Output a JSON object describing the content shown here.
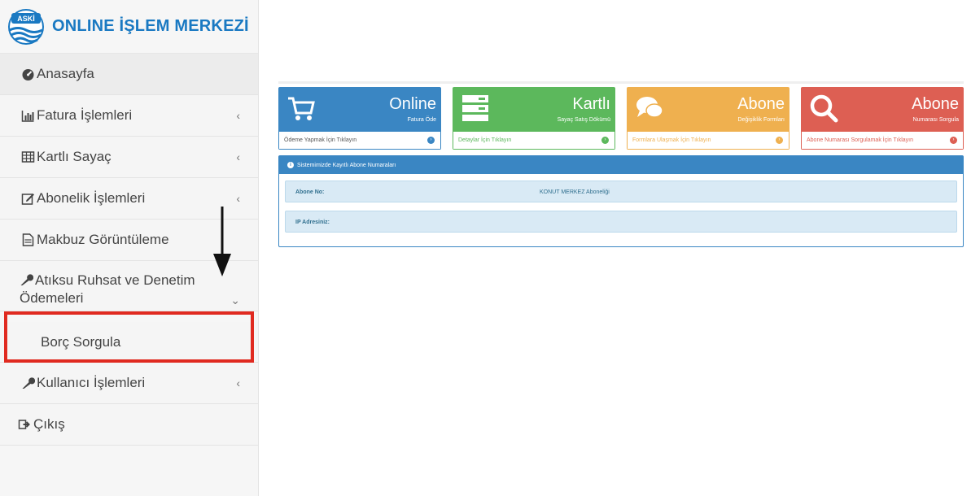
{
  "brand": {
    "logo_text": "ASKİ",
    "title": "ONLINE İŞLEM MERKEZİ"
  },
  "sidebar": {
    "items": [
      {
        "label": "Anasayfa",
        "icon": "dashboard-icon"
      },
      {
        "label": "Fatura İşlemleri",
        "icon": "bar-chart-icon",
        "chevron": "‹"
      },
      {
        "label": "Kartlı Sayaç",
        "icon": "table-icon",
        "chevron": "‹"
      },
      {
        "label": "Abonelik İşlemleri",
        "icon": "edit-icon",
        "chevron": "‹"
      },
      {
        "label": "Makbuz Görüntüleme",
        "icon": "file-icon"
      },
      {
        "label": "Atıksu Ruhsat ve Denetim Ödemeleri",
        "icon": "wrench-icon",
        "chevron": "⌄"
      },
      {
        "label": "Kullanıcı İşlemleri",
        "icon": "wrench-icon",
        "chevron": "‹"
      },
      {
        "label": "Çıkış",
        "icon": "sign-out-icon"
      }
    ],
    "submenu": {
      "label": "Borç Sorgula"
    }
  },
  "cards": [
    {
      "title": "Online",
      "sub": "Fatura Öde",
      "footer": "Ödeme Yapmak İçin Tıklayın",
      "icon": "cart-icon"
    },
    {
      "title": "Kartlı",
      "sub": "Sayaç Satış Dökümü",
      "footer": "Detaylar İçin Tıklayın",
      "icon": "server-icon"
    },
    {
      "title": "Abone",
      "sub": "Değişiklik Formları",
      "footer": "Formlara Ulaşmak İçin Tıklayın",
      "icon": "comments-icon"
    },
    {
      "title": "Abone",
      "sub": "Numarası Sorgula",
      "footer": "Abone Numarası Sorgulamak İçin Tıklayın",
      "icon": "search-icon"
    }
  ],
  "panel": {
    "header": "Sistemimizde Kayıtlı Abone Numaraları",
    "rows": [
      {
        "label": "Abone No:",
        "value": "KONUT MERKEZ Aboneliği"
      },
      {
        "label": "IP Adresiniz:",
        "value": ""
      }
    ]
  },
  "colors": {
    "blue": "#3a86c3",
    "green": "#5cb85c",
    "orange": "#efb04f",
    "red": "#dd5f53",
    "highlight": "#e02a20"
  }
}
